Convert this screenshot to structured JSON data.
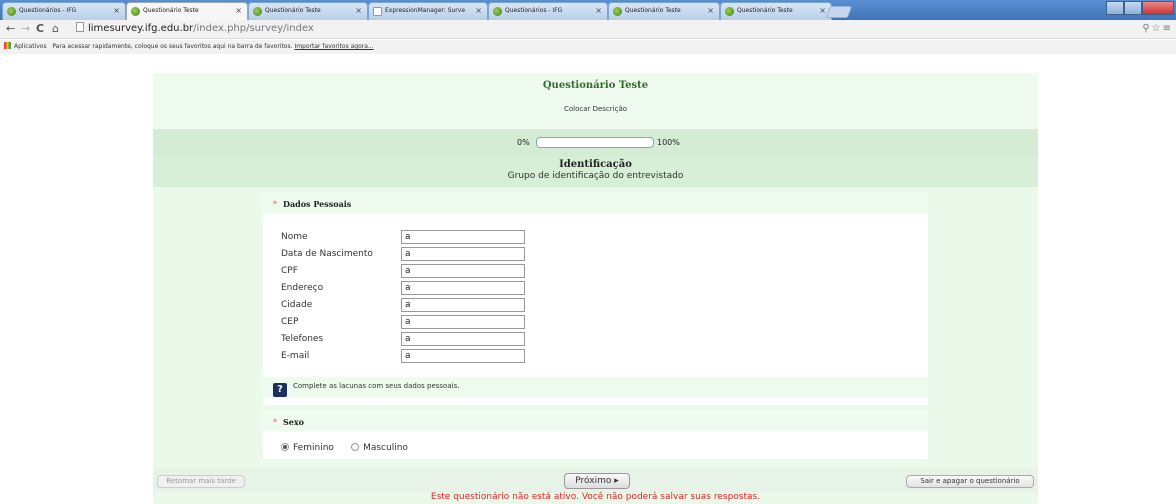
{
  "browser": {
    "tabs": [
      {
        "title": "Questionários - IFG",
        "icon": "limesurvey-icon"
      },
      {
        "title": "Questionário Teste",
        "icon": "limesurvey-icon",
        "active": true
      },
      {
        "title": "Questionário Teste",
        "icon": "limesurvey-icon"
      },
      {
        "title": "ExpressionManager: Surve",
        "icon": "page-icon"
      },
      {
        "title": "Questionários - IFG",
        "icon": "limesurvey-icon"
      },
      {
        "title": "Questionário Teste",
        "icon": "limesurvey-icon"
      },
      {
        "title": "Questionário Teste",
        "icon": "limesurvey-icon"
      }
    ],
    "close_glyph": "×",
    "nav": {
      "back": "←",
      "forward": "→",
      "reload": "C",
      "home": "⌂"
    },
    "address": {
      "domain": "limesurvey.ifg.edu.br",
      "path": "/index.php/survey/index"
    },
    "toolbar_right": "⚲☆≡",
    "bookmarks": {
      "apps": "Aplicativos",
      "hint": "Para acessar rapidamente, coloque os seus favoritos aqui na barra de favoritos.",
      "import_link": "Importar favoritos agora..."
    }
  },
  "survey": {
    "title": "Questionário Teste",
    "description": "Colocar Descrição",
    "progress": {
      "min_label": "0%",
      "max_label": "100%",
      "value": 0
    },
    "group": {
      "title": "Identificação",
      "description": "Grupo de identificação do entrevistado"
    },
    "questions": {
      "personal": {
        "required_mark": "*",
        "title": "Dados Pessoais",
        "fields": [
          {
            "label": "Nome",
            "value": "a"
          },
          {
            "label": "Data de Nascimento",
            "value": "a"
          },
          {
            "label": "CPF",
            "value": "a"
          },
          {
            "label": "Endereço",
            "value": "a"
          },
          {
            "label": "Cidade",
            "value": "a"
          },
          {
            "label": "CEP",
            "value": "a"
          },
          {
            "label": "Telefones",
            "value": "a"
          },
          {
            "label": "E-mail",
            "value": "a"
          }
        ],
        "help_icon": "?",
        "help_text": "Complete as lacunas com seus dados pessoais."
      },
      "sex": {
        "required_mark": "*",
        "title": "Sexo",
        "options": [
          {
            "label": "Feminino",
            "selected": true
          },
          {
            "label": "Masculino",
            "selected": false
          }
        ]
      }
    },
    "footer": {
      "later": "Retomar mais tarde",
      "next": "Próximo ▸",
      "exit": "Sair e apagar o questionário",
      "warning": "Este questionário não está ativo. Você não poderá salvar suas respostas."
    }
  },
  "colors": {
    "accent": "#2f6b2f",
    "warning": "#e22",
    "panel": "#eaf9ea"
  }
}
